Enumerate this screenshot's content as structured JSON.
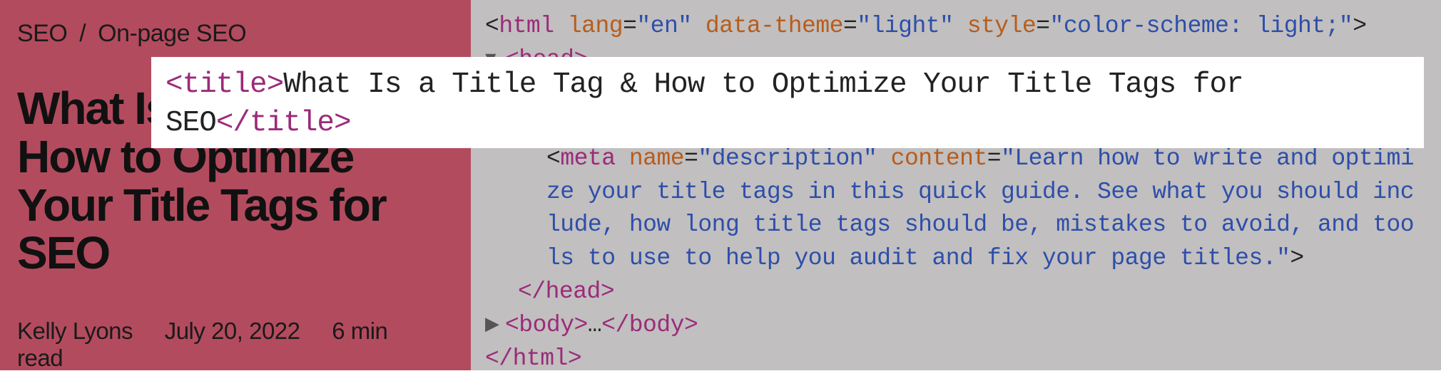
{
  "breadcrumb": {
    "item1": "SEO",
    "separator": "/",
    "item2": "On-page SEO"
  },
  "article": {
    "title": "What Is a Title Tag & How to Optimize Your Title Tags for SEO",
    "author": "Kelly Lyons",
    "date": "July 20, 2022",
    "readTime": "6 min read"
  },
  "overlay": {
    "tagOpen": "<title>",
    "text": "What Is a Title Tag & How to Optimize Your Title Tags for SEO",
    "tagClose": "</title>"
  },
  "code": {
    "htmlOpen": {
      "tag": "html",
      "attr1Name": "lang",
      "attr1Value": "\"en\"",
      "attr2Name": "data-theme",
      "attr2Value": "\"light\"",
      "attr3Name": "style",
      "attr3Value": "\"color-scheme: light;\""
    },
    "headOpen": "<head>",
    "meta": {
      "tag": "meta",
      "attr1Name": "name",
      "attr1Value": "\"description\"",
      "attr2Name": "content",
      "attr2Value": "\"Learn how to write and optimize your title tags in this quick guide. See what you should include, how long title tags should be, mistakes to avoid, and tools to use to help you audit and fix your page titles.\""
    },
    "headClose": "</head>",
    "bodyOpen": "<body>",
    "bodyEllipsis": "…",
    "bodyClose": "</body>",
    "htmlClose": "</html>"
  }
}
